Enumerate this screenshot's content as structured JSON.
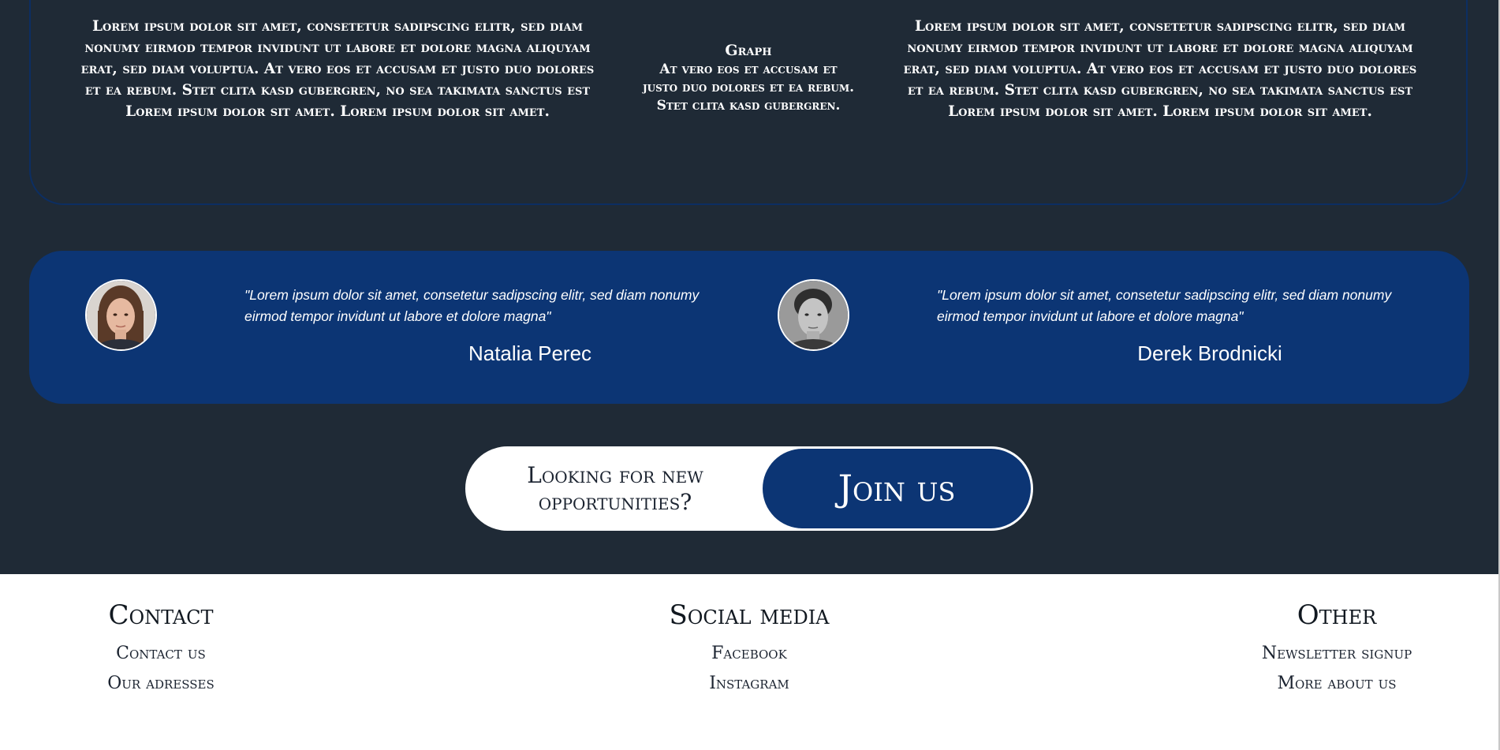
{
  "info": {
    "left_text": "Lorem ipsum dolor sit amet, consetetur sadipscing elitr, sed diam nonumy eirmod tempor invidunt ut labore et dolore magna aliquyam erat, sed diam voluptua. At vero eos et accusam et justo duo dolores et ea rebum. Stet clita kasd gubergren, no sea takimata sanctus est Lorem ipsum dolor sit amet. Lorem ipsum dolor sit amet.",
    "graph_title": "Graph",
    "graph_text": "At vero eos et accusam et justo duo dolores et ea rebum. Stet clita kasd gubergren.",
    "right_text": "Lorem ipsum dolor sit amet, consetetur sadipscing elitr, sed diam nonumy eirmod tempor invidunt ut labore et dolore magna aliquyam erat, sed diam voluptua. At vero eos et accusam et justo duo dolores et ea rebum. Stet clita kasd gubergren, no sea takimata sanctus est Lorem ipsum dolor sit amet. Lorem ipsum dolor sit amet."
  },
  "testimonials": [
    {
      "quote": "\"Lorem ipsum dolor sit amet, consetetur sadipscing elitr, sed diam nonumy eirmod tempor invidunt ut labore et dolore magna\"",
      "name": "Natalia Perec",
      "avatar": "woman-portrait-photo"
    },
    {
      "quote": "\"Lorem ipsum dolor sit amet, consetetur sadipscing elitr, sed diam nonumy eirmod tempor invidunt ut labore et dolore magna\"",
      "name": "Derek Brodnicki",
      "avatar": "man-portrait-photo"
    }
  ],
  "cta": {
    "prompt": "Looking for new opportunities?",
    "button_label": "Join us"
  },
  "footer": {
    "contact": {
      "heading": "Contact",
      "links": [
        "Contact us",
        "Our adresses"
      ]
    },
    "social": {
      "heading": "Social media",
      "links": [
        "Facebook",
        "Instagram"
      ]
    },
    "other": {
      "heading": "Other",
      "links": [
        "Newsletter signup",
        "More about us"
      ]
    }
  },
  "colors": {
    "dark_background": "#1f2a36",
    "brand_blue": "#0c3574",
    "panel_border": "#0c2e62",
    "footer_background": "#ffffff"
  }
}
